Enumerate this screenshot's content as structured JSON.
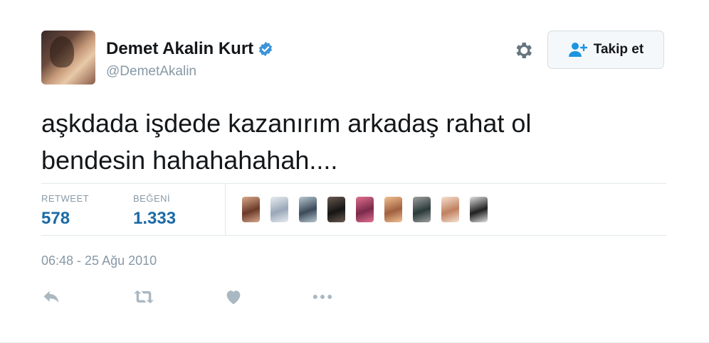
{
  "user": {
    "display_name": "Demet Akalin Kurt",
    "handle": "@DemetAkalin",
    "verified": true,
    "verified_color": "#3b94d9"
  },
  "follow_button": {
    "label": "Takip et",
    "icon": "add-user-icon"
  },
  "settings_icon": "gear-icon",
  "tweet": {
    "text": "aşkdada işdede kazanırım arkadaş rahat ol\nbendesin hahahahahah...."
  },
  "stats": {
    "retweet_label": "RETWEET",
    "retweet_count": "578",
    "like_label": "BEĞENİ",
    "like_count": "1.333",
    "value_color": "#1b6aa5"
  },
  "likers": [
    {
      "color_a": "#6b3a2a",
      "color_b": "#d8a88a"
    },
    {
      "color_a": "#9aa7b8",
      "color_b": "#e8ecf0"
    },
    {
      "color_a": "#3a4a5a",
      "color_b": "#b8c8d0"
    },
    {
      "color_a": "#151515",
      "color_b": "#6a5a50"
    },
    {
      "color_a": "#7a2a4a",
      "color_b": "#e07090"
    },
    {
      "color_a": "#a06040",
      "color_b": "#f0c090"
    },
    {
      "color_a": "#2a3a3a",
      "color_b": "#a0a0a0"
    },
    {
      "color_a": "#c08060",
      "color_b": "#f5e0d0"
    },
    {
      "color_a": "#202020",
      "color_b": "#e0e0e0"
    }
  ],
  "timestamp": "06:48 - 25 Ağu 2010",
  "actions": [
    "reply-icon",
    "retweet-icon",
    "like-icon",
    "more-icon"
  ],
  "colors": {
    "action_icon": "#aab8c2",
    "secondary_text": "#8899a6"
  }
}
